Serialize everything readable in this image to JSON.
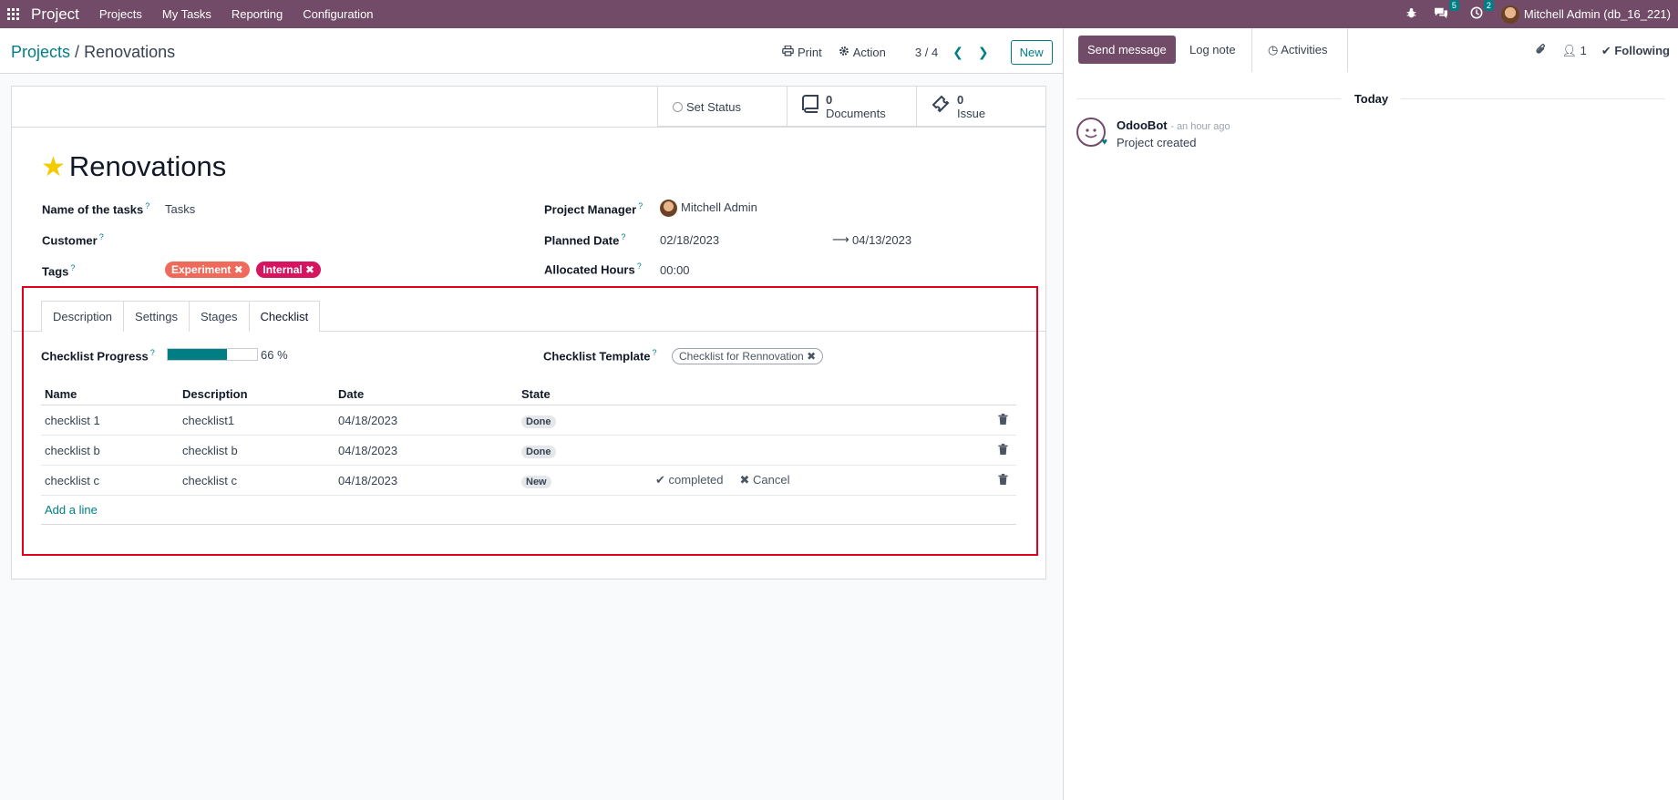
{
  "navbar": {
    "brand": "Project",
    "menu": [
      "Projects",
      "My Tasks",
      "Reporting",
      "Configuration"
    ],
    "messages_count": "5",
    "activities_count": "2",
    "user": "Mitchell Admin (db_16_221)"
  },
  "control_panel": {
    "breadcrumb_parent": "Projects",
    "breadcrumb_separator": "/",
    "breadcrumb_current": "Renovations",
    "print_label": "Print",
    "action_label": "Action",
    "pager": "3 / 4",
    "new_label": "New"
  },
  "stat_buttons": {
    "set_status": "Set Status",
    "documents_count": "0",
    "documents_label": "Documents",
    "issue_count": "0",
    "issue_label": "Issue"
  },
  "form": {
    "title": "Renovations",
    "name_of_tasks_label": "Name of the tasks",
    "name_of_tasks_value": "Tasks",
    "customer_label": "Customer",
    "tags_label": "Tags",
    "tags": [
      "Experiment",
      "Internal"
    ],
    "project_manager_label": "Project Manager",
    "project_manager_value": "Mitchell Admin",
    "planned_date_label": "Planned Date",
    "planned_date_start": "02/18/2023",
    "planned_date_end": "04/13/2023",
    "allocated_hours_label": "Allocated Hours",
    "allocated_hours_value": "00:00",
    "help_mark": "?"
  },
  "notebook": {
    "tabs": [
      "Description",
      "Settings",
      "Stages",
      "Checklist"
    ],
    "active_tab": "Checklist",
    "checklist_progress_label": "Checklist Progress",
    "checklist_progress_value": 66,
    "checklist_progress_text": "66 %",
    "checklist_template_label": "Checklist Template",
    "checklist_template_value": "Checklist for Rennovation",
    "columns": [
      "Name",
      "Description",
      "Date",
      "State"
    ],
    "rows": [
      {
        "name": "checklist 1",
        "description": "checklist1",
        "date": "04/18/2023",
        "state": "Done"
      },
      {
        "name": "checklist b",
        "description": "checklist b",
        "date": "04/18/2023",
        "state": "Done"
      },
      {
        "name": "checklist c",
        "description": "checklist c",
        "date": "04/18/2023",
        "state": "New",
        "complete_label": "completed",
        "cancel_label": "Cancel"
      }
    ],
    "add_line_label": "Add a line"
  },
  "chatter": {
    "send_message_label": "Send message",
    "log_note_label": "Log note",
    "activities_label": "Activities",
    "followers_count": "1",
    "following_label": "Following",
    "date_separator": "Today",
    "message": {
      "author": "OdooBot",
      "time": "- an hour ago",
      "body": "Project created"
    }
  },
  "colors": {
    "brand": "#714b67",
    "accent": "#017e84",
    "highlight_box": "#e3001b",
    "tag_experiment": "#ef6a5a",
    "tag_internal": "#d6145f",
    "following": "#28a745"
  }
}
